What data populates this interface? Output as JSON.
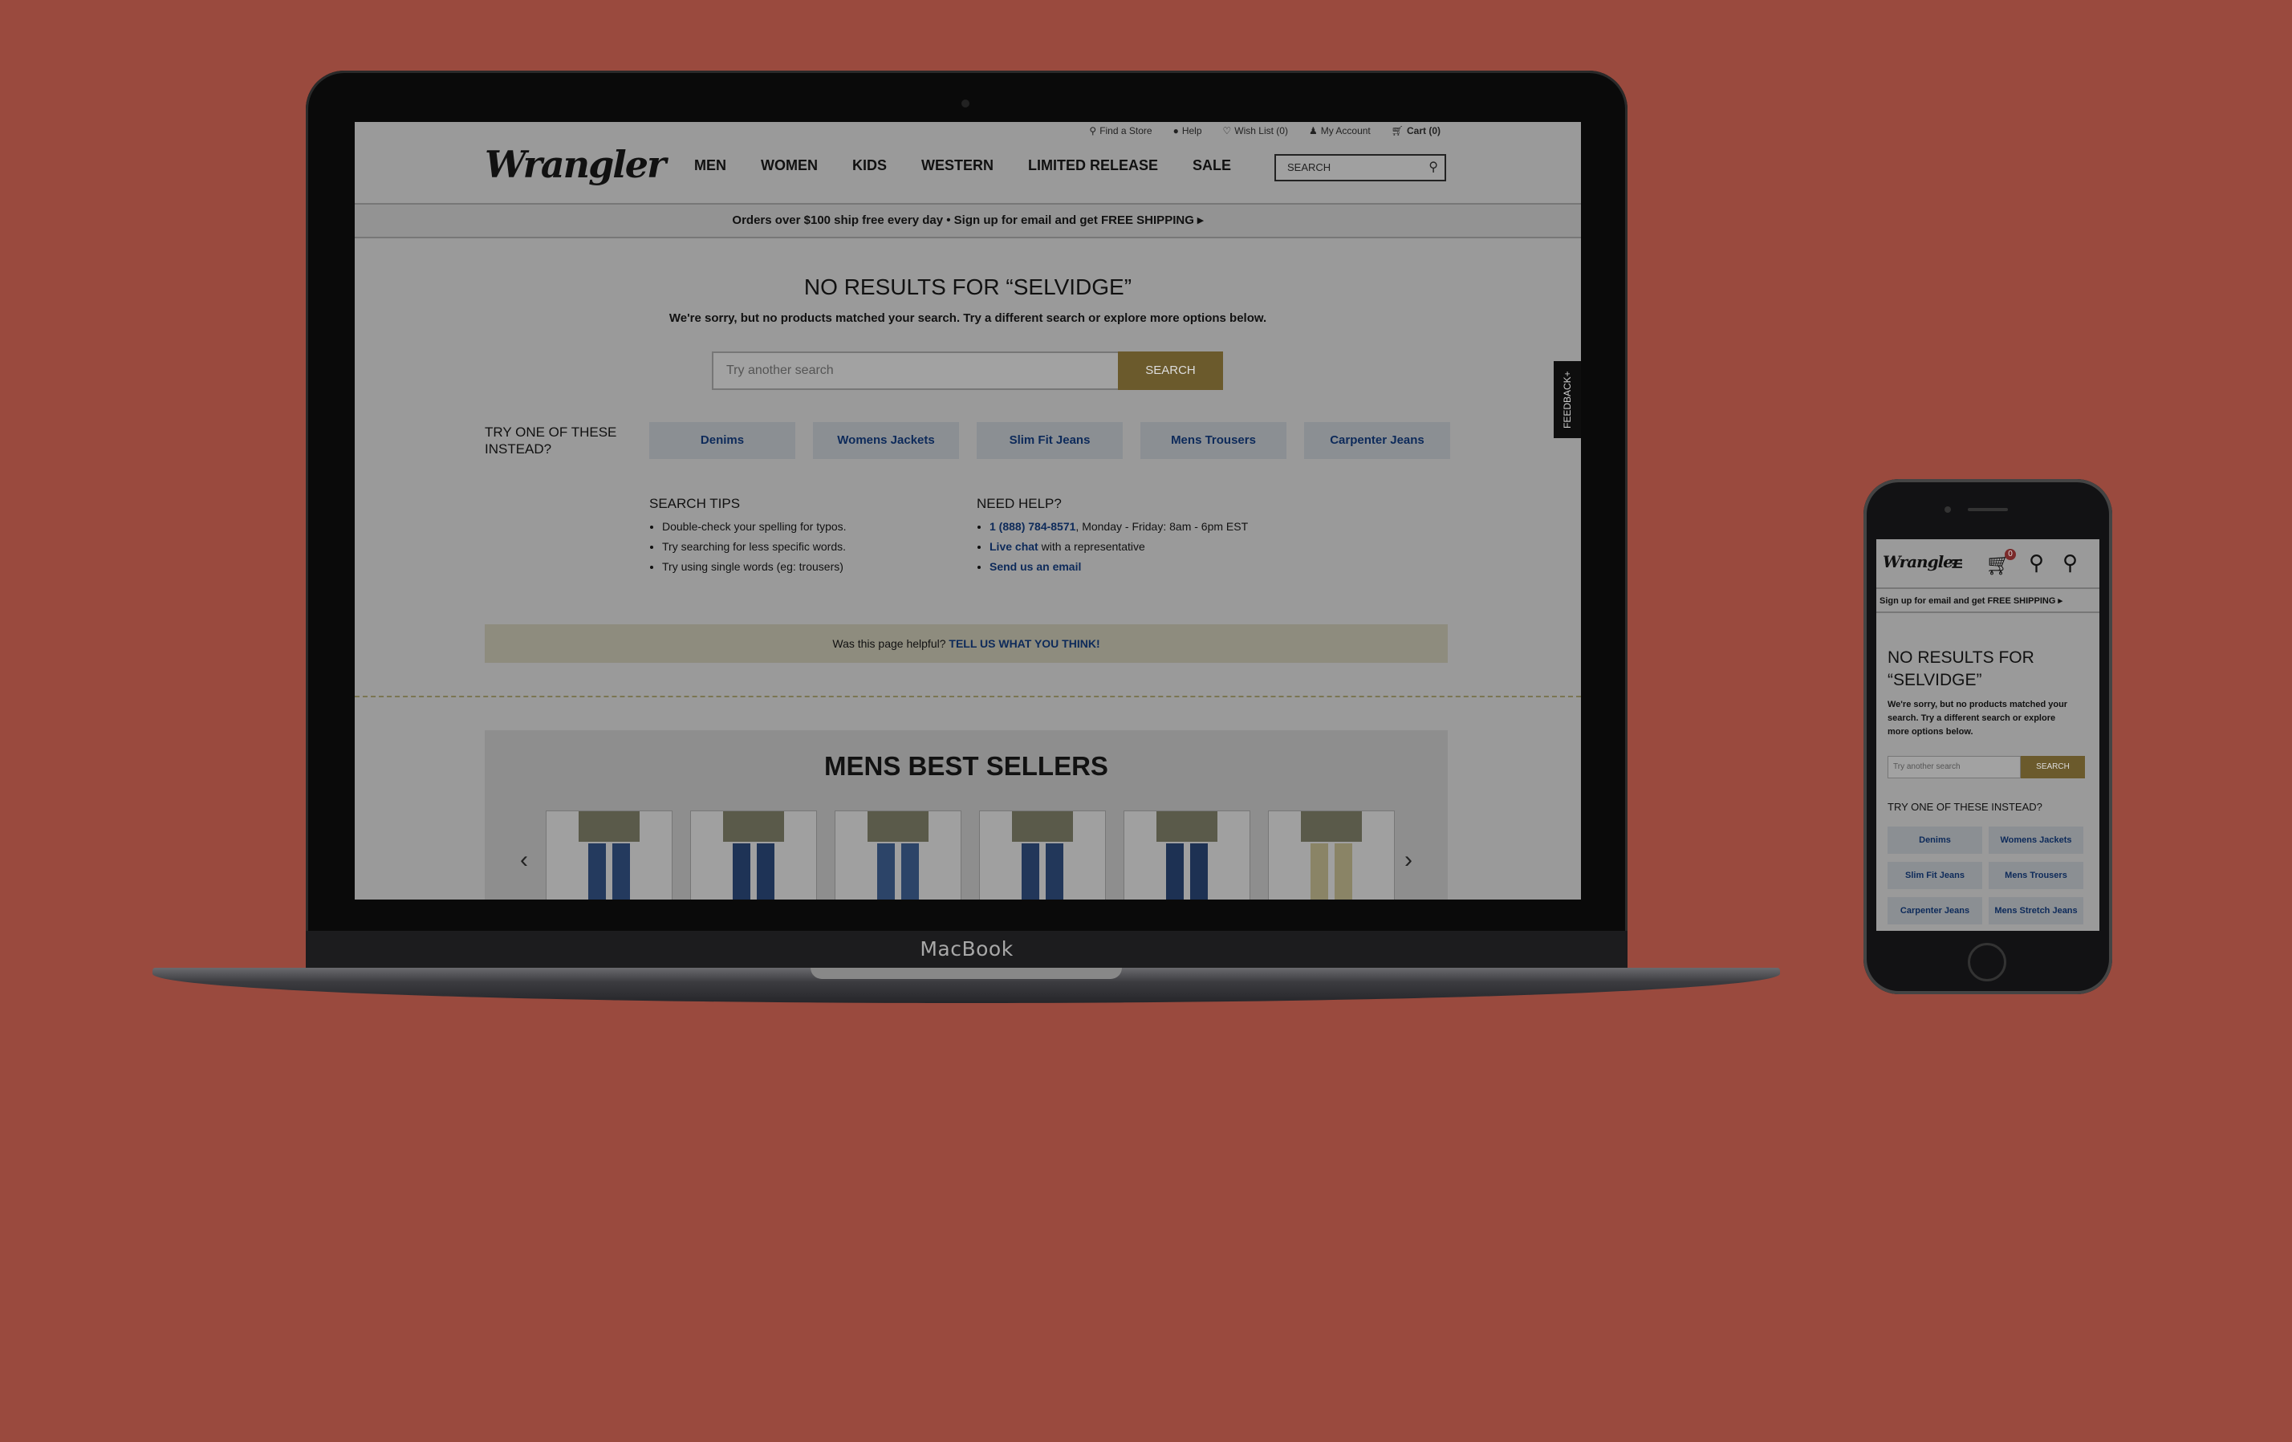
{
  "laptop": {
    "brand_label": "MacBook",
    "utility_nav": [
      "Find a Store",
      "Help",
      "Wish List (0)",
      "My Account",
      "Cart (0)"
    ],
    "logo": "Wrangler",
    "main_nav": [
      "MEN",
      "WOMEN",
      "KIDS",
      "WESTERN",
      "LIMITED RELEASE",
      "SALE"
    ],
    "search_placeholder": "SEARCH",
    "promo": "Orders over $100 ship free every day  •  Sign up for email and get FREE SHIPPING  ▸",
    "no_results_title": "NO RESULTS FOR “SELVIDGE”",
    "no_results_sub": "We're sorry, but no products matched your search. Try a different search or explore more options below.",
    "retry_placeholder": "Try another search",
    "retry_button": "SEARCH",
    "feedback_tab": "FEEDBACK+",
    "try_label": "TRY ONE OF THESE INSTEAD?",
    "suggestions": [
      "Denims",
      "Womens Jackets",
      "Slim Fit Jeans",
      "Mens Trousers",
      "Carpenter Jeans"
    ],
    "search_tips": {
      "heading": "SEARCH TIPS",
      "items": [
        "Double-check your spelling for typos.",
        "Try searching for less specific words.",
        "Try using single words (eg: trousers)"
      ]
    },
    "need_help": {
      "heading": "NEED HELP?",
      "phone": "1 (888) 784-8571",
      "phone_hours": ", Monday - Friday: 8am - 6pm EST",
      "chat_link": "Live chat",
      "chat_rest": " with a representative",
      "email_link": "Send us an email"
    },
    "helpful_text": "Was this page helpful? ",
    "helpful_link": "TELL US WHAT YOU THINK!",
    "best_sellers_title": "MENS BEST SELLERS",
    "product_colors": [
      "#243a5e",
      "#1e3356",
      "#2c4468",
      "#22375a",
      "#1d3153",
      "#8a8466"
    ]
  },
  "phone": {
    "logo": "Wrangler",
    "cart_count": "0",
    "promo": "Sign up for email and get FREE SHIPPING  ▸",
    "no_results_title": "NO RESULTS FOR “SELVIDGE”",
    "no_results_sub": "We're sorry, but no products matched your search. Try a different search or explore more options below.",
    "retry_placeholder": "Try another search",
    "retry_button": "SEARCH",
    "try_label": "TRY ONE OF THESE INSTEAD?",
    "suggestions": [
      "Denims",
      "Womens Jackets",
      "Slim Fit Jeans",
      "Mens Trousers",
      "Carpenter Jeans",
      "Mens Stretch Jeans"
    ]
  },
  "colors": {
    "background": "#9a4a3e",
    "accent_button": "#6b5a2c",
    "link": "#0d2a5a"
  }
}
